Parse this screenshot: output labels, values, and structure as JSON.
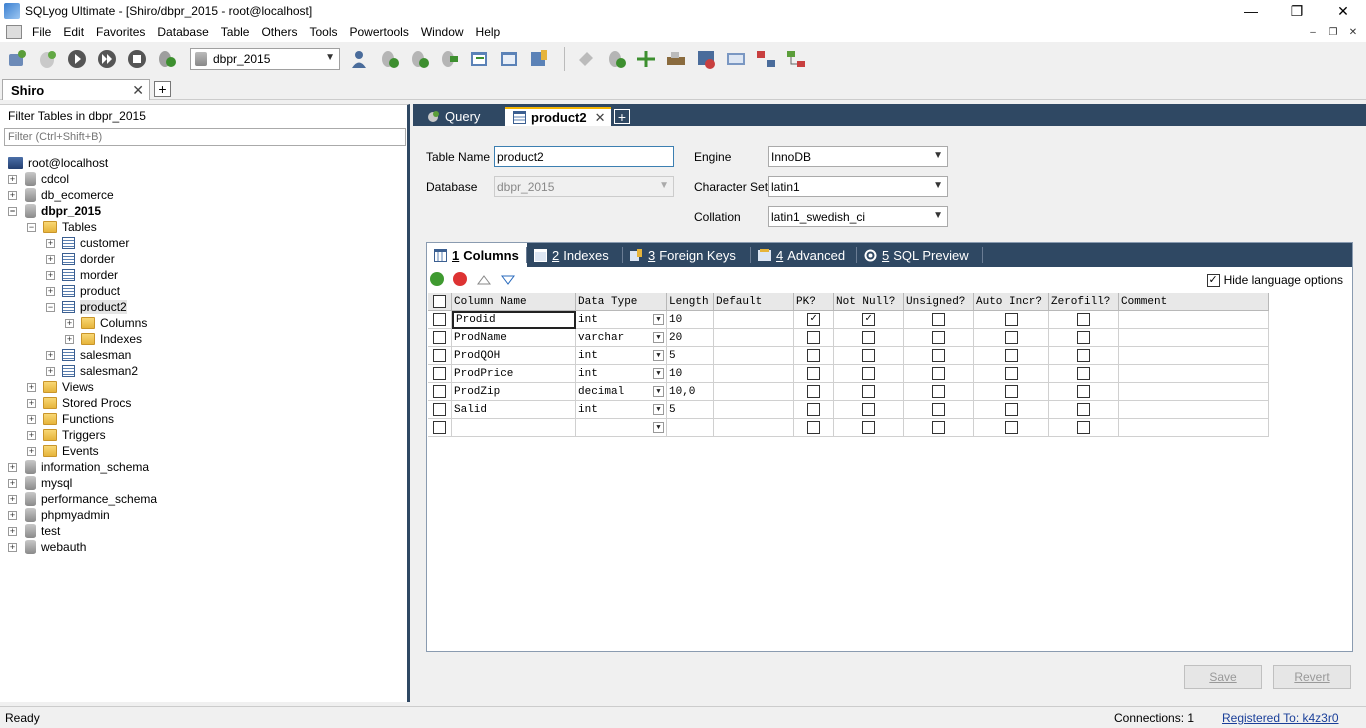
{
  "window": {
    "title": "SQLyog Ultimate - [Shiro/dbpr_2015 - root@localhost]",
    "controls": [
      "—",
      "❐",
      "✕"
    ]
  },
  "menu": {
    "items": [
      "File",
      "Edit",
      "Favorites",
      "Database",
      "Table",
      "Others",
      "Tools",
      "Powertools",
      "Window",
      "Help"
    ],
    "mdi_controls": [
      "–",
      "❐",
      "✕"
    ]
  },
  "toolbar": {
    "database_select": "dbpr_2015"
  },
  "connection_tabs": {
    "active": "Shiro",
    "close": "✕",
    "add": "+"
  },
  "object_browser": {
    "filter_label": "Filter Tables in dbpr_2015",
    "filter_placeholder": "Filter (Ctrl+Shift+B)",
    "tree": [
      {
        "label": "root@localhost",
        "icon": "server-icon",
        "level": 0,
        "exp": ""
      },
      {
        "label": "cdcol",
        "icon": "database-icon",
        "level": 0,
        "exp": "+"
      },
      {
        "label": "db_ecomerce",
        "icon": "database-icon",
        "level": 0,
        "exp": "+"
      },
      {
        "label": "dbpr_2015",
        "icon": "database-icon",
        "level": 0,
        "exp": "−",
        "bold": true
      },
      {
        "label": "Tables",
        "icon": "folder-icon",
        "level": 1,
        "exp": "−"
      },
      {
        "label": "customer",
        "icon": "table-icon",
        "level": 2,
        "exp": "+"
      },
      {
        "label": "dorder",
        "icon": "table-icon",
        "level": 2,
        "exp": "+"
      },
      {
        "label": "morder",
        "icon": "table-icon",
        "level": 2,
        "exp": "+"
      },
      {
        "label": "product",
        "icon": "table-icon",
        "level": 2,
        "exp": "+"
      },
      {
        "label": "product2",
        "icon": "table-icon",
        "level": 2,
        "exp": "−",
        "selected": true
      },
      {
        "label": "Columns",
        "icon": "folder-icon",
        "level": 3,
        "exp": "+"
      },
      {
        "label": "Indexes",
        "icon": "folder-icon",
        "level": 3,
        "exp": "+"
      },
      {
        "label": "salesman",
        "icon": "table-icon",
        "level": 2,
        "exp": "+"
      },
      {
        "label": "salesman2",
        "icon": "table-icon",
        "level": 2,
        "exp": "+"
      },
      {
        "label": "Views",
        "icon": "folder-icon",
        "level": 1,
        "exp": "+"
      },
      {
        "label": "Stored Procs",
        "icon": "folder-icon",
        "level": 1,
        "exp": "+"
      },
      {
        "label": "Functions",
        "icon": "folder-icon",
        "level": 1,
        "exp": "+"
      },
      {
        "label": "Triggers",
        "icon": "folder-icon",
        "level": 1,
        "exp": "+"
      },
      {
        "label": "Events",
        "icon": "folder-icon",
        "level": 1,
        "exp": "+"
      },
      {
        "label": "information_schema",
        "icon": "database-icon",
        "level": 0,
        "exp": "+"
      },
      {
        "label": "mysql",
        "icon": "database-icon",
        "level": 0,
        "exp": "+"
      },
      {
        "label": "performance_schema",
        "icon": "database-icon",
        "level": 0,
        "exp": "+"
      },
      {
        "label": "phpmyadmin",
        "icon": "database-icon",
        "level": 0,
        "exp": "+"
      },
      {
        "label": "test",
        "icon": "database-icon",
        "level": 0,
        "exp": "+"
      },
      {
        "label": "webauth",
        "icon": "database-icon",
        "level": 0,
        "exp": "+"
      }
    ]
  },
  "editor_tabs": {
    "query": "Query",
    "product2": "product2",
    "close": "✕",
    "add": "+"
  },
  "table_form": {
    "table_name_label": "Table Name",
    "table_name_value": "product2",
    "database_label": "Database",
    "database_value": "dbpr_2015",
    "engine_label": "Engine",
    "engine_value": "InnoDB",
    "charset_label": "Character Set",
    "charset_value": "latin1",
    "collation_label": "Collation",
    "collation_value": "latin1_swedish_ci"
  },
  "inner_tabs": [
    {
      "num": "1",
      "label": "Columns"
    },
    {
      "num": "2",
      "label": "Indexes"
    },
    {
      "num": "3",
      "label": "Foreign Keys"
    },
    {
      "num": "4",
      "label": "Advanced"
    },
    {
      "num": "5",
      "label": "SQL Preview"
    }
  ],
  "hide_language_options": "Hide language options",
  "columns_grid": {
    "headers": [
      "Column Name",
      "Data Type",
      "Length",
      "Default",
      "PK?",
      "Not Null?",
      "Unsigned?",
      "Auto Incr?",
      "Zerofill?",
      "Comment"
    ],
    "rows": [
      {
        "name": "Prodid",
        "type": "int",
        "length": "10",
        "default": "",
        "pk": true,
        "notnull": true,
        "unsigned": false,
        "autoinc": false,
        "zerofill": false,
        "comment": ""
      },
      {
        "name": "ProdName",
        "type": "varchar",
        "length": "20",
        "default": "",
        "pk": false,
        "notnull": false,
        "unsigned": false,
        "autoinc": false,
        "zerofill": false,
        "comment": ""
      },
      {
        "name": "ProdQOH",
        "type": "int",
        "length": "5",
        "default": "",
        "pk": false,
        "notnull": false,
        "unsigned": false,
        "autoinc": false,
        "zerofill": false,
        "comment": ""
      },
      {
        "name": "ProdPrice",
        "type": "int",
        "length": "10",
        "default": "",
        "pk": false,
        "notnull": false,
        "unsigned": false,
        "autoinc": false,
        "zerofill": false,
        "comment": ""
      },
      {
        "name": "ProdZip",
        "type": "decimal",
        "length": "10,0",
        "default": "",
        "pk": false,
        "notnull": false,
        "unsigned": false,
        "autoinc": false,
        "zerofill": false,
        "comment": ""
      },
      {
        "name": "Salid",
        "type": "int",
        "length": "5",
        "default": "",
        "pk": false,
        "notnull": false,
        "unsigned": false,
        "autoinc": false,
        "zerofill": false,
        "comment": ""
      },
      {
        "name": "",
        "type": "",
        "length": "",
        "default": "",
        "pk": false,
        "notnull": false,
        "unsigned": false,
        "autoinc": false,
        "zerofill": false,
        "comment": ""
      }
    ]
  },
  "buttons": {
    "save": "Save",
    "revert": "Revert"
  },
  "status": {
    "ready": "Ready",
    "connections": "Connections: 1",
    "registered": "Registered To: k4z3r0"
  },
  "colors": {
    "tab_bar": "#2f4863",
    "active_tab_accent": "#f4b400",
    "link": "#1a3f99"
  }
}
